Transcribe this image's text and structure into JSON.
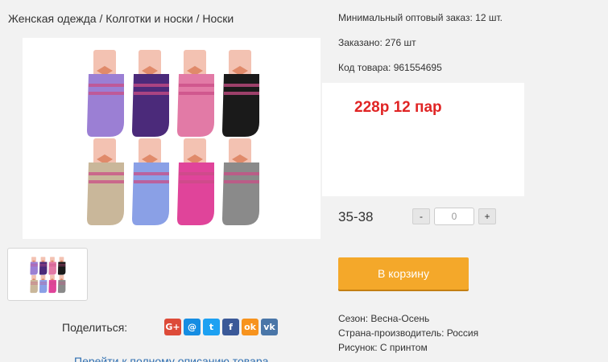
{
  "breadcrumb": "Женская одежда / Колготки и носки / Носки",
  "product": {
    "min_order": "Минимальный оптовый заказ: 12 шт.",
    "ordered": "Заказано: 276 шт",
    "code": "Код товара: 961554695",
    "price": "228р 12 пар",
    "size": "35-38",
    "qty_value": "0",
    "qty_minus": "-",
    "qty_plus": "+",
    "cart_label": "В корзину",
    "season": "Сезон: Весна-Осень",
    "country": "Страна-производитель: Россия",
    "pattern": "Рисунок: С принтом"
  },
  "share": {
    "label": "Поделиться:",
    "icons": [
      {
        "name": "google-plus-icon",
        "glyph": "G+",
        "color": "#dd4b39"
      },
      {
        "name": "mail-ru-icon",
        "glyph": "@",
        "color": "#168de2"
      },
      {
        "name": "twitter-icon",
        "glyph": "t",
        "color": "#1da1f2"
      },
      {
        "name": "facebook-icon",
        "glyph": "f",
        "color": "#3b5998"
      },
      {
        "name": "odnoklassniki-icon",
        "glyph": "ok",
        "color": "#f7931e"
      },
      {
        "name": "vk-icon",
        "glyph": "vk",
        "color": "#4a76a8"
      }
    ]
  },
  "full_description_link": "Перейти к полному описанию товара",
  "sock_colors": [
    "#9b7fd4",
    "#4b2a7a",
    "#e27aa6",
    "#1a1a1a",
    "#c9b79a",
    "#8aa0e6",
    "#e0449a",
    "#8a8a8a"
  ]
}
